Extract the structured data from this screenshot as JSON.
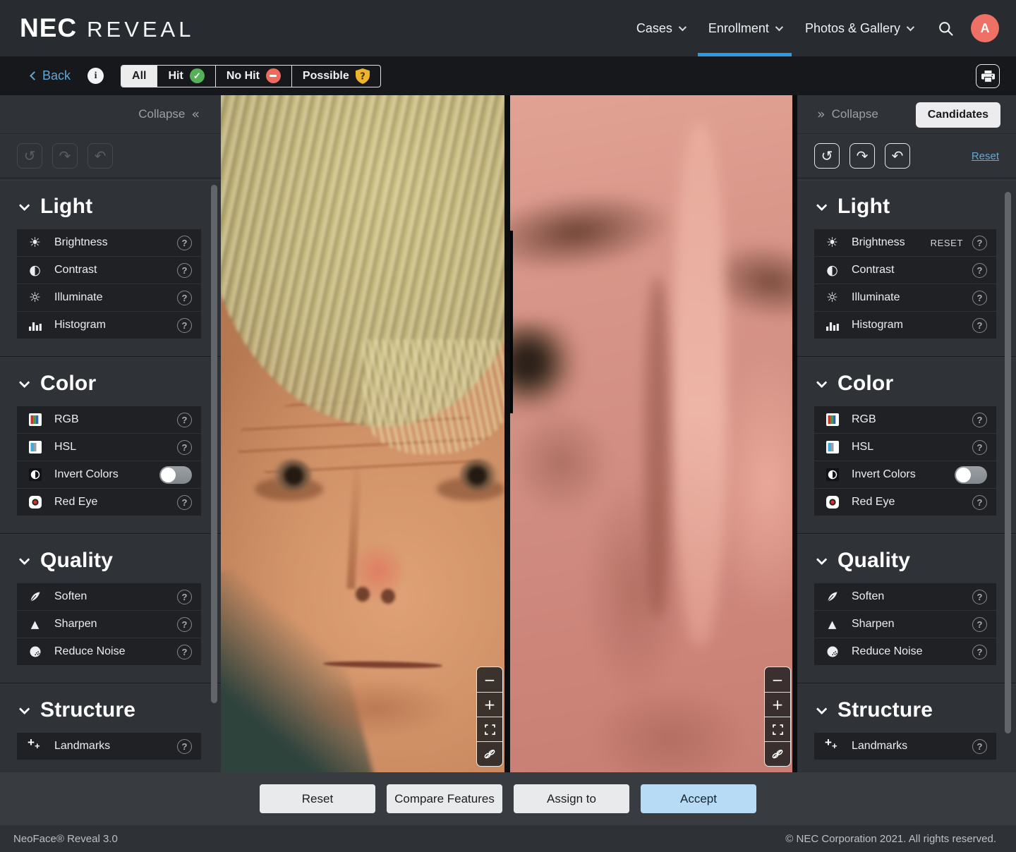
{
  "header": {
    "brand": {
      "logo": "NEC",
      "product": "REVEAL"
    },
    "nav": [
      {
        "label": "Cases"
      },
      {
        "label": "Enrollment",
        "active": true
      },
      {
        "label": "Photos & Gallery"
      }
    ],
    "avatar_initial": "A"
  },
  "filter_bar": {
    "back_label": "Back",
    "tabs": [
      {
        "label": "All",
        "state": "selected"
      },
      {
        "label": "Hit",
        "icon": "hit-check-icon",
        "icon_glyph": "✓"
      },
      {
        "label": "No Hit",
        "icon": "no-hit-minus-icon"
      },
      {
        "label": "Possible",
        "icon": "possible-shield-icon",
        "icon_glyph": "?"
      }
    ]
  },
  "left_panel": {
    "collapse_label": "Collapse",
    "toolbar": [
      "history-icon",
      "redo-icon",
      "undo-icon"
    ],
    "sections": [
      {
        "title": "Light",
        "rows": [
          {
            "label": "Brightness",
            "icon": "brightness-icon"
          },
          {
            "label": "Contrast",
            "icon": "contrast-icon"
          },
          {
            "label": "Illuminate",
            "icon": "illuminate-icon"
          },
          {
            "label": "Histogram",
            "icon": "histogram-icon"
          }
        ]
      },
      {
        "title": "Color",
        "rows": [
          {
            "label": "RGB",
            "icon": "rgb-icon"
          },
          {
            "label": "HSL",
            "icon": "hsl-icon"
          },
          {
            "label": "Invert Colors",
            "icon": "invert-colors-icon",
            "toggle": "off"
          },
          {
            "label": "Red Eye",
            "icon": "red-eye-icon"
          }
        ]
      },
      {
        "title": "Quality",
        "rows": [
          {
            "label": "Soften",
            "icon": "soften-icon"
          },
          {
            "label": "Sharpen",
            "icon": "sharpen-icon"
          },
          {
            "label": "Reduce Noise",
            "icon": "reduce-noise-icon"
          }
        ]
      },
      {
        "title": "Structure",
        "rows": [
          {
            "label": "Landmarks",
            "icon": "landmarks-icon"
          }
        ]
      }
    ]
  },
  "right_panel": {
    "collapse_label": "Collapse",
    "candidates_label": "Candidates",
    "reset_link": "Reset",
    "toolbar": [
      "history-icon",
      "redo-icon",
      "undo-icon"
    ],
    "sections": [
      {
        "title": "Light",
        "rows": [
          {
            "label": "Brightness",
            "icon": "brightness-icon",
            "reset_label": "RESET"
          },
          {
            "label": "Contrast",
            "icon": "contrast-icon"
          },
          {
            "label": "Illuminate",
            "icon": "illuminate-icon"
          },
          {
            "label": "Histogram",
            "icon": "histogram-icon"
          }
        ]
      },
      {
        "title": "Color",
        "rows": [
          {
            "label": "RGB",
            "icon": "rgb-icon"
          },
          {
            "label": "HSL",
            "icon": "hsl-icon"
          },
          {
            "label": "Invert Colors",
            "icon": "invert-colors-icon",
            "toggle": "off"
          },
          {
            "label": "Red Eye",
            "icon": "red-eye-icon"
          }
        ]
      },
      {
        "title": "Quality",
        "rows": [
          {
            "label": "Soften",
            "icon": "soften-icon"
          },
          {
            "label": "Sharpen",
            "icon": "sharpen-icon"
          },
          {
            "label": "Reduce Noise",
            "icon": "reduce-noise-icon"
          }
        ]
      },
      {
        "title": "Structure",
        "rows": [
          {
            "label": "Landmarks",
            "icon": "landmarks-icon"
          }
        ]
      }
    ]
  },
  "viewer": {
    "controls": [
      {
        "name": "zoom-out",
        "glyph": "−"
      },
      {
        "name": "zoom-in",
        "glyph": "+"
      },
      {
        "name": "fit-screen"
      },
      {
        "name": "unlink"
      }
    ]
  },
  "action_bar": {
    "buttons": [
      {
        "label": "Reset"
      },
      {
        "label": "Compare Features"
      },
      {
        "label": "Assign to"
      },
      {
        "label": "Accept",
        "accent": true
      }
    ]
  },
  "footer": {
    "left": "NeoFace® Reveal 3.0",
    "right": "© NEC Corporation 2021. All rights reserved."
  },
  "icons": {
    "brightness-icon": "☀",
    "contrast-icon": "◐",
    "illuminate-icon": "☼",
    "sharpen-icon": "▲",
    "history-icon": "↺",
    "redo-icon": "↷",
    "undo-icon": "↶",
    "collapse-left-icon": "«",
    "collapse-right-icon": "»",
    "help-icon": "?"
  },
  "colors": {
    "accent_blue": "#2e9ae4",
    "link_blue": "#5ea9d8",
    "avatar_coral": "#ef7165",
    "hit_green": "#53b158",
    "no_hit_red": "#ee6a5e",
    "possible_yellow": "#f0b42a",
    "accept_button": "#b7dbf4"
  }
}
